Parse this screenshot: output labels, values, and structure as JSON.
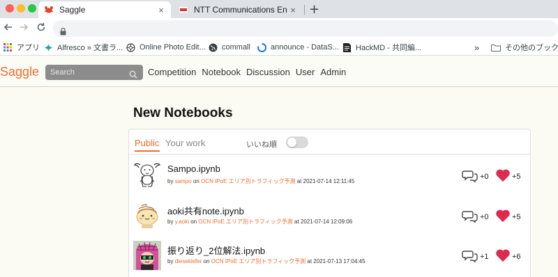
{
  "browser": {
    "tabs": [
      {
        "title": "Saggle",
        "active": true
      },
      {
        "title": "NTT Communications Engineer",
        "active": false
      }
    ],
    "new_tab": "+",
    "close": "×",
    "bookmarks": [
      {
        "label": "アプリ",
        "icon": "apps-grid-icon"
      },
      {
        "label": "Alfresco » 文書ラ...",
        "icon": "alfresco-icon"
      },
      {
        "label": "Online Photo Edit...",
        "icon": "aperture-icon"
      },
      {
        "label": "commall",
        "icon": "globe-icon"
      },
      {
        "label": "announce - DataS...",
        "icon": "datasphere-icon"
      },
      {
        "label": "HackMD - 共同編...",
        "icon": "hackmd-icon"
      }
    ],
    "bookmarks_overflow": "»",
    "other_bookmarks": "その他のブックマー"
  },
  "site": {
    "brand": "Saggle",
    "search_placeholder": "Search",
    "nav": [
      "Competition",
      "Notebook",
      "Discussion",
      "User",
      "Admin"
    ]
  },
  "main": {
    "title": "New Notebooks",
    "tabs": {
      "public": "Public",
      "your_work": "Your work"
    },
    "sort_label": "いいね順",
    "sort_by_likes": false,
    "notebooks": [
      {
        "title": "Sampo.ipynb",
        "by": "by",
        "author": "sampo",
        "on": "on",
        "competition": "OCN IPoE エリア別トラフィック予測",
        "at": "at 2021-07-14 12:11:45",
        "comments": "+0",
        "likes": "+5",
        "avatar": "goat-avatar"
      },
      {
        "title": "aoki共有note.ipynb",
        "by": "by",
        "author": "y.aoki",
        "on": "on",
        "competition": "OCN IPoE エリア別トラフィック予測",
        "at": "at 2021-07-14 12:09:06",
        "comments": "+0",
        "likes": "+5",
        "avatar": "bun-character-avatar"
      },
      {
        "title": "振り返り_2位解法.ipynb",
        "by": "by",
        "author": "diesekiefer",
        "on": "on",
        "competition": "OCN IPoE エリア別トラフィック予測",
        "at": "at 2021-07-13 17:04:45",
        "comments": "+1",
        "likes": "+6",
        "avatar": "squid-character-avatar"
      }
    ]
  },
  "colors": {
    "accent": "#f26b2c",
    "heart": "#e0294f",
    "tab_strip": "#dee1e6",
    "page_bg": "#fbfbf3"
  }
}
